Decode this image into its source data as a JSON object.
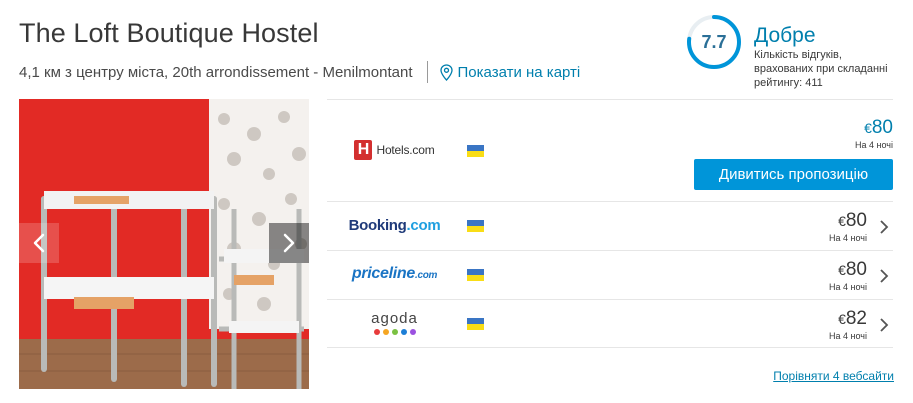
{
  "hotel": {
    "name": "The Loft Boutique Hostel",
    "location": "4,1 км з центру міста, 20th arrondissement - Menilmontant",
    "map_link": "Показати на карті"
  },
  "rating": {
    "score": "7.7",
    "score_fraction": 0.77,
    "label": "Добре",
    "note": "Кількість відгуків, врахованих при складанні рейтингу: 411",
    "ring_color": "#0095d9"
  },
  "offers": [
    {
      "provider": "Hotels.com",
      "logo_text": "Hotels.com",
      "currency": "€",
      "amount": "80",
      "nights": "На 4 ночі",
      "cta": "Дивитись пропозицію",
      "flag": "ukraine-flag-icon"
    },
    {
      "provider": "Booking.com",
      "logo_main": "Booking",
      "logo_dot": ".com",
      "currency": "€",
      "amount": "80",
      "nights": "На 4 ночі",
      "flag": "ukraine-flag-icon"
    },
    {
      "provider": "priceline.com",
      "logo_main": "priceline",
      "logo_dot": ".com",
      "currency": "€",
      "amount": "80",
      "nights": "На 4 ночі",
      "flag": "ukraine-flag-icon"
    },
    {
      "provider": "agoda",
      "logo_text": "agoda",
      "currency": "€",
      "amount": "82",
      "nights": "На 4 ночі",
      "flag": "ukraine-flag-icon"
    }
  ],
  "compare_link": "Порівняти 4 вебсайти",
  "icons": {
    "map_pin": "map-pin-icon",
    "prev": "chevron-left-icon",
    "next": "chevron-right-icon",
    "row_chevron": "chevron-right-icon"
  },
  "colors": {
    "accent": "#0095d9",
    "link": "#007fad",
    "photo_wall": "#e22a25",
    "agoda_dots": [
      "#e83b3b",
      "#f5a623",
      "#7ac142",
      "#1c7ed6",
      "#9b51e0"
    ]
  }
}
